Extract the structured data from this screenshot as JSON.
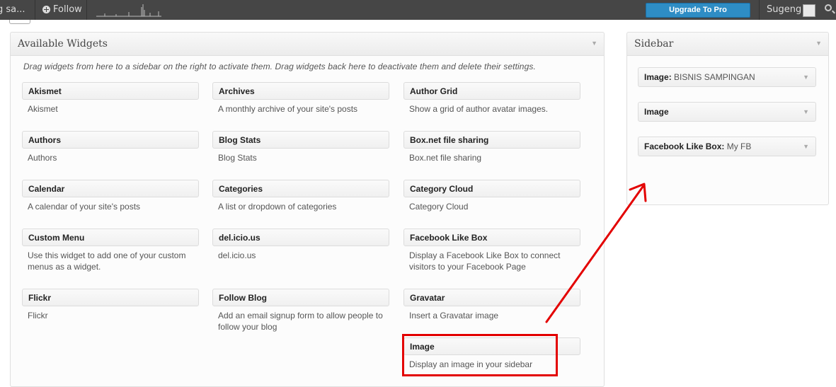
{
  "topbar": {
    "site_label": "g sa...",
    "follow_label": "Follow",
    "upgrade_label": "Upgrade To Pro",
    "user_name": "Sugeng"
  },
  "available": {
    "title": "Available Widgets",
    "description": "Drag widgets from here to a sidebar on the right to activate them. Drag widgets back here to deactivate them and delete their settings.",
    "widgets": [
      {
        "title": "Akismet",
        "desc": "Akismet"
      },
      {
        "title": "Archives",
        "desc": "A monthly archive of your site's posts"
      },
      {
        "title": "Author Grid",
        "desc": "Show a grid of author avatar images."
      },
      {
        "title": "Authors",
        "desc": "Authors"
      },
      {
        "title": "Blog Stats",
        "desc": "Blog Stats"
      },
      {
        "title": "Box.net file sharing",
        "desc": "Box.net file sharing"
      },
      {
        "title": "Calendar",
        "desc": "A calendar of your site's posts"
      },
      {
        "title": "Categories",
        "desc": "A list or dropdown of categories"
      },
      {
        "title": "Category Cloud",
        "desc": "Category Cloud"
      },
      {
        "title": "Custom Menu",
        "desc": "Use this widget to add one of your custom menus as a widget."
      },
      {
        "title": "del.icio.us",
        "desc": "del.icio.us"
      },
      {
        "title": "Facebook Like Box",
        "desc": "Display a Facebook Like Box to connect visitors to your Facebook Page"
      },
      {
        "title": "Flickr",
        "desc": "Flickr"
      },
      {
        "title": "Follow Blog",
        "desc": "Add an email signup form to allow people to follow your blog"
      },
      {
        "title": "Gravatar",
        "desc": "Insert a Gravatar image"
      },
      {
        "title": "Image",
        "desc": "Display an image in your sidebar"
      }
    ]
  },
  "sidebar": {
    "title": "Sidebar",
    "widgets": [
      {
        "name": "Image",
        "sep": ": ",
        "value": "BISNIS SAMPINGAN"
      },
      {
        "name": "Image",
        "sep": "",
        "value": ""
      },
      {
        "name": "Facebook Like Box",
        "sep": ": ",
        "value": "My FB"
      }
    ]
  },
  "colors": {
    "admin_bar": "#464646",
    "upgrade_button": "#2e8dc5",
    "annotation": "#e30000"
  },
  "icons": {
    "follow": "plus-circle-icon",
    "search": "search-icon",
    "collapse": "triangle-down-icon"
  }
}
